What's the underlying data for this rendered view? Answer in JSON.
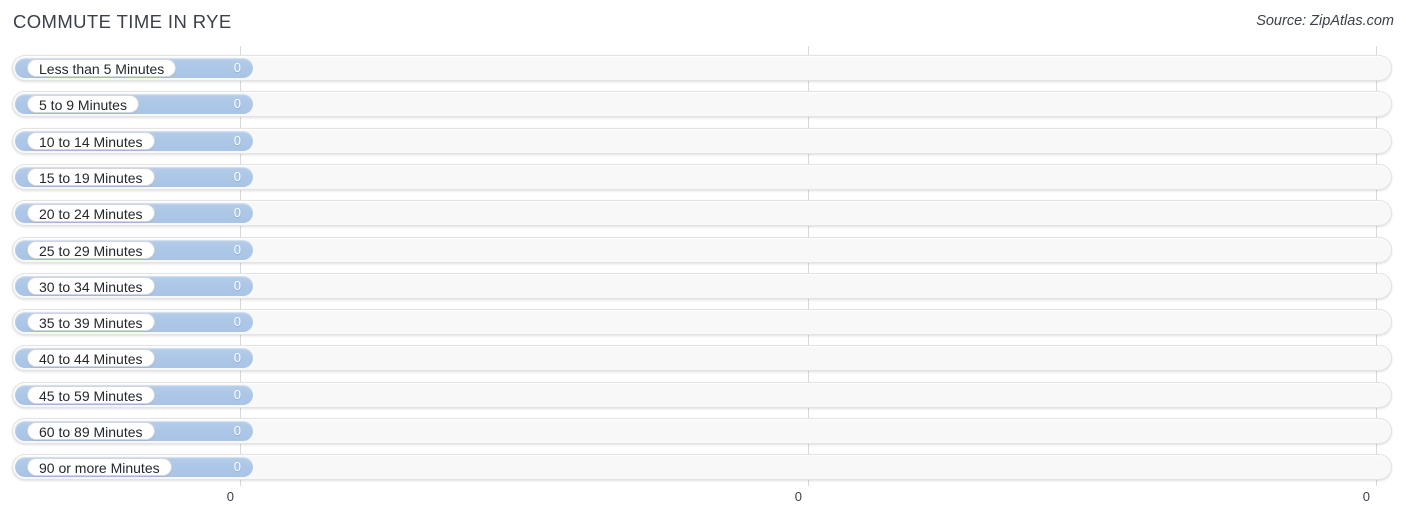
{
  "header": {
    "title": "COMMUTE TIME IN RYE",
    "source": "Source: ZipAtlas.com"
  },
  "chart_data": {
    "type": "bar",
    "orientation": "horizontal",
    "title": "COMMUTE TIME IN RYE",
    "xlabel": "",
    "ylabel": "",
    "xlim": [
      0,
      0
    ],
    "grid": true,
    "legend": null,
    "categories": [
      "Less than 5 Minutes",
      "5 to 9 Minutes",
      "10 to 14 Minutes",
      "15 to 19 Minutes",
      "20 to 24 Minutes",
      "25 to 29 Minutes",
      "30 to 34 Minutes",
      "35 to 39 Minutes",
      "40 to 44 Minutes",
      "45 to 59 Minutes",
      "60 to 89 Minutes",
      "90 or more Minutes"
    ],
    "values": [
      0,
      0,
      0,
      0,
      0,
      0,
      0,
      0,
      0,
      0,
      0,
      0
    ],
    "value_labels": [
      "0",
      "0",
      "0",
      "0",
      "0",
      "0",
      "0",
      "0",
      "0",
      "0",
      "0",
      "0"
    ],
    "x_tick_labels": [
      "0",
      "0",
      "0"
    ],
    "colors": {
      "bar": "#adc7e7",
      "track": "#f8f8f8",
      "gridline": "#d9d9d9",
      "label_pill": "#ffffff",
      "text": "#23282e",
      "title": "#3c4149",
      "value_text": "#ffffff"
    }
  }
}
